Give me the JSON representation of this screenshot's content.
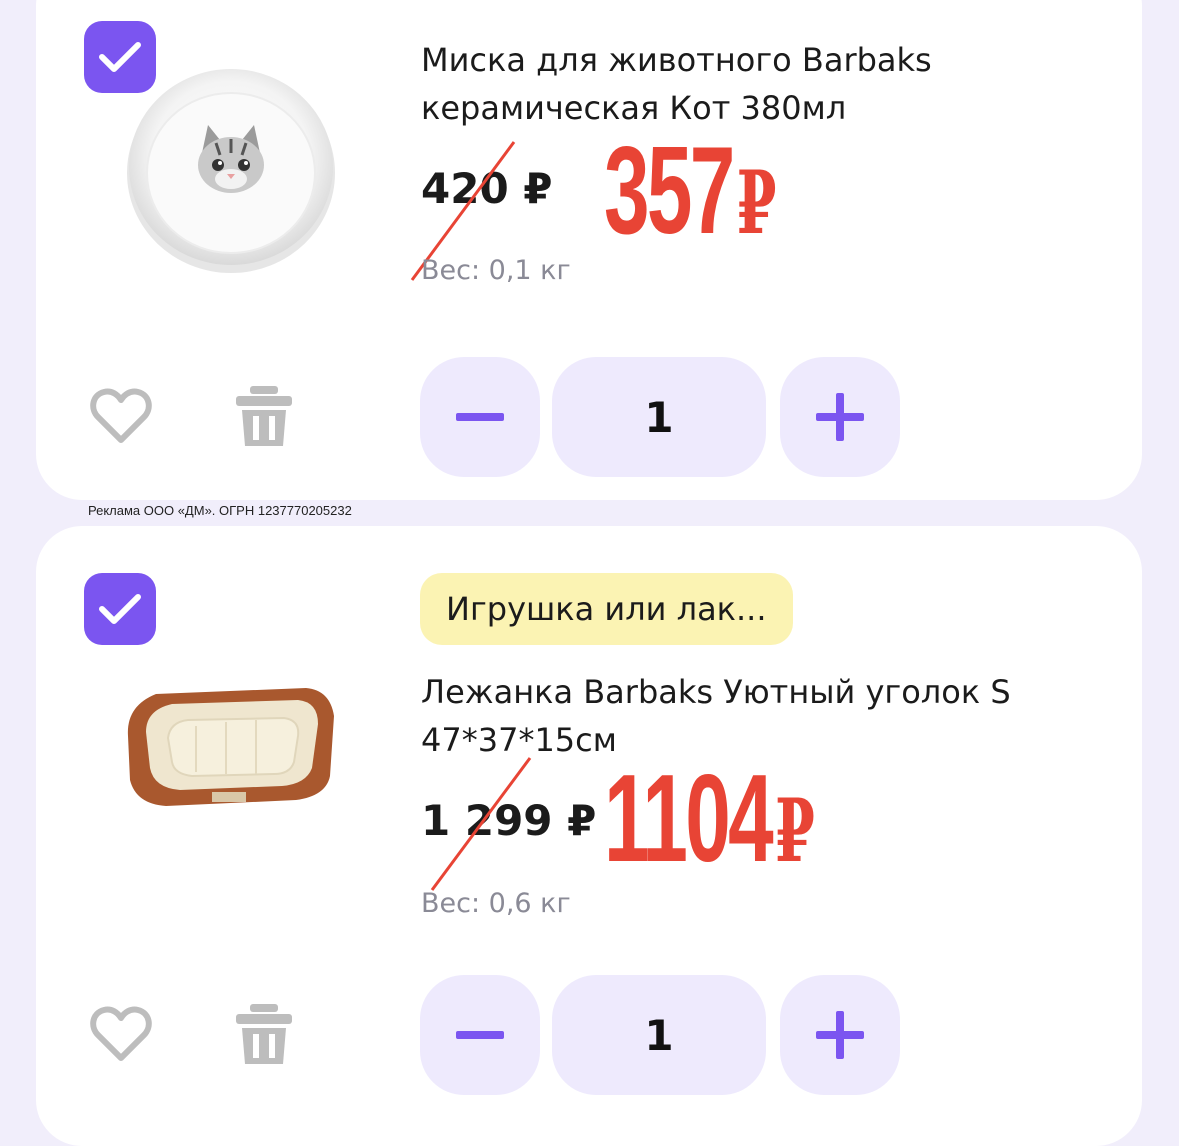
{
  "items": [
    {
      "checked": true,
      "image_icon": "ceramic-bowl-with-cat-image",
      "badge": "",
      "title": "Миска для животного Barbaks керамическая Кот 380мл",
      "old_price": "420 ₽",
      "new_price": "357",
      "currency": "₽",
      "weight": "Вес: 0,1 кг",
      "quantity": "1"
    },
    {
      "checked": true,
      "image_icon": "brown-pet-bed-image",
      "badge": "Игрушка или лак...",
      "title": "Лежанка Barbaks Уютный уголок S 47*37*15см",
      "old_price": "1 299 ₽",
      "new_price": "1104",
      "currency": "₽",
      "weight": "Вес: 0,6 кг",
      "quantity": "1"
    }
  ],
  "ad_label": "Реклама ООО «ДМ». ОГРН 1237770205232",
  "colors": {
    "accent": "#7b55f0",
    "new_price": "#e84435",
    "badge_bg": "#fbf3b3",
    "stepper_bg": "#eeeafd",
    "icon_gray": "#bdbdbd"
  }
}
